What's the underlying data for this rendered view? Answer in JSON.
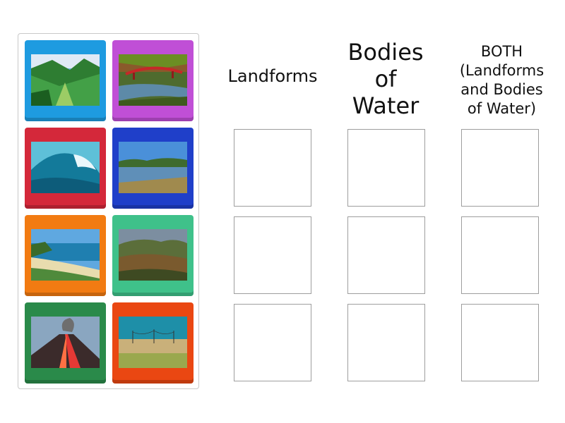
{
  "headers": {
    "landforms": "Landforms",
    "bodies_of_water": [
      "Bodies",
      "of",
      "Water"
    ],
    "both": [
      "BOTH",
      "(Landforms",
      "and Bodies",
      "of Water)"
    ]
  },
  "cards": [
    {
      "name": "valley",
      "color": "#1e9be0"
    },
    {
      "name": "river-bridge",
      "color": "#c04fd6"
    },
    {
      "name": "ocean-wave",
      "color": "#d4283a"
    },
    {
      "name": "lake",
      "color": "#1f3fc9"
    },
    {
      "name": "beach-coast",
      "color": "#f27b12"
    },
    {
      "name": "hills",
      "color": "#3fc18a"
    },
    {
      "name": "volcano",
      "color": "#2a8a4a"
    },
    {
      "name": "plains",
      "color": "#ea4712"
    }
  ],
  "columns": [
    "landforms",
    "bodies-of-water",
    "both"
  ],
  "rows": 3
}
